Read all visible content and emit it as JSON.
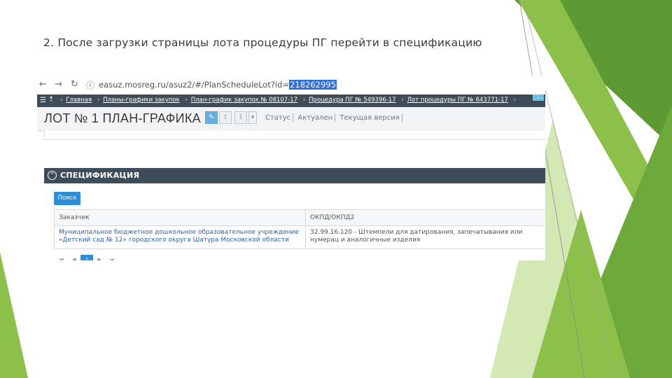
{
  "slide": {
    "title": "2. После загрузки страницы лота процедуры ПГ перейти в спецификацию"
  },
  "colors": {
    "green_dark": "#5a9b2e",
    "green_mid": "#7fba3d",
    "green_light": "#b9db86",
    "nav_bar": "#3f4d5a",
    "accent_blue": "#2d8dd6"
  },
  "browser": {
    "back_icon": "arrow-left-icon",
    "forward_icon": "arrow-right-icon",
    "reload_icon": "reload-icon",
    "info_icon": "info-icon",
    "url_prefix": "easuz.mosreg.ru/asuz2/#/PlanScheduleLot?id=",
    "url_highlight": "218262995"
  },
  "breadcrumbs": {
    "items": [
      "Главная",
      "Планы-графики закупок",
      "План-график закупок № 08107-17",
      "Процедура ПГ № 549396-17",
      "Лот процедуры ПГ № 643771-17"
    ],
    "separator": "›"
  },
  "lot": {
    "title": "ЛОТ № 1 ПЛАН-ГРАФИКА",
    "status_label": "Статус",
    "status_value": "Актуален",
    "version_label": "Текущая версия"
  },
  "specification": {
    "title": "СПЕЦИФИКАЦИЯ",
    "search_button": "Поиск",
    "columns": [
      "Заказчик",
      "ОКПД/ОКПД2"
    ],
    "rows": [
      {
        "customer": "Муниципальное бюджетное дошкольное образовательное учреждение «Детский сад № 12» городского округа Шатура Московской области",
        "okpd": "32.99.16.120 - Штемпели для датирования, запечатывания или нумерац и аналогичные изделия"
      }
    ],
    "pager": {
      "first": "⏮",
      "prev": "◀",
      "current": "1",
      "next": "▶",
      "last": "⏭"
    }
  }
}
